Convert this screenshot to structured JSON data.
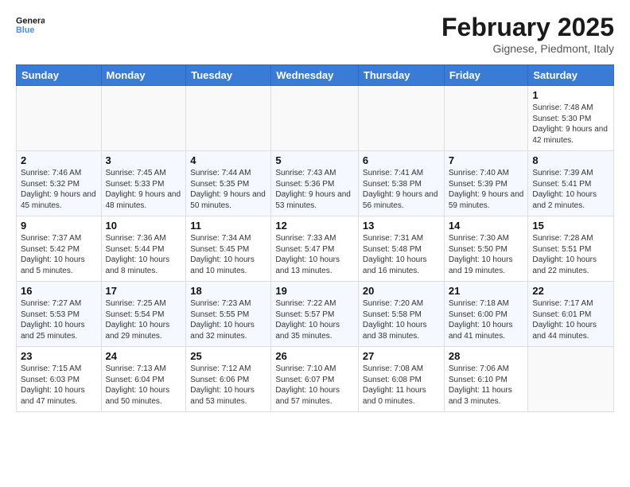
{
  "header": {
    "logo_line1": "General",
    "logo_line2": "Blue",
    "month_title": "February 2025",
    "location": "Gignese, Piedmont, Italy"
  },
  "weekdays": [
    "Sunday",
    "Monday",
    "Tuesday",
    "Wednesday",
    "Thursday",
    "Friday",
    "Saturday"
  ],
  "weeks": [
    [
      {
        "day": "",
        "info": ""
      },
      {
        "day": "",
        "info": ""
      },
      {
        "day": "",
        "info": ""
      },
      {
        "day": "",
        "info": ""
      },
      {
        "day": "",
        "info": ""
      },
      {
        "day": "",
        "info": ""
      },
      {
        "day": "1",
        "info": "Sunrise: 7:48 AM\nSunset: 5:30 PM\nDaylight: 9 hours and 42 minutes."
      }
    ],
    [
      {
        "day": "2",
        "info": "Sunrise: 7:46 AM\nSunset: 5:32 PM\nDaylight: 9 hours and 45 minutes."
      },
      {
        "day": "3",
        "info": "Sunrise: 7:45 AM\nSunset: 5:33 PM\nDaylight: 9 hours and 48 minutes."
      },
      {
        "day": "4",
        "info": "Sunrise: 7:44 AM\nSunset: 5:35 PM\nDaylight: 9 hours and 50 minutes."
      },
      {
        "day": "5",
        "info": "Sunrise: 7:43 AM\nSunset: 5:36 PM\nDaylight: 9 hours and 53 minutes."
      },
      {
        "day": "6",
        "info": "Sunrise: 7:41 AM\nSunset: 5:38 PM\nDaylight: 9 hours and 56 minutes."
      },
      {
        "day": "7",
        "info": "Sunrise: 7:40 AM\nSunset: 5:39 PM\nDaylight: 9 hours and 59 minutes."
      },
      {
        "day": "8",
        "info": "Sunrise: 7:39 AM\nSunset: 5:41 PM\nDaylight: 10 hours and 2 minutes."
      }
    ],
    [
      {
        "day": "9",
        "info": "Sunrise: 7:37 AM\nSunset: 5:42 PM\nDaylight: 10 hours and 5 minutes."
      },
      {
        "day": "10",
        "info": "Sunrise: 7:36 AM\nSunset: 5:44 PM\nDaylight: 10 hours and 8 minutes."
      },
      {
        "day": "11",
        "info": "Sunrise: 7:34 AM\nSunset: 5:45 PM\nDaylight: 10 hours and 10 minutes."
      },
      {
        "day": "12",
        "info": "Sunrise: 7:33 AM\nSunset: 5:47 PM\nDaylight: 10 hours and 13 minutes."
      },
      {
        "day": "13",
        "info": "Sunrise: 7:31 AM\nSunset: 5:48 PM\nDaylight: 10 hours and 16 minutes."
      },
      {
        "day": "14",
        "info": "Sunrise: 7:30 AM\nSunset: 5:50 PM\nDaylight: 10 hours and 19 minutes."
      },
      {
        "day": "15",
        "info": "Sunrise: 7:28 AM\nSunset: 5:51 PM\nDaylight: 10 hours and 22 minutes."
      }
    ],
    [
      {
        "day": "16",
        "info": "Sunrise: 7:27 AM\nSunset: 5:53 PM\nDaylight: 10 hours and 25 minutes."
      },
      {
        "day": "17",
        "info": "Sunrise: 7:25 AM\nSunset: 5:54 PM\nDaylight: 10 hours and 29 minutes."
      },
      {
        "day": "18",
        "info": "Sunrise: 7:23 AM\nSunset: 5:55 PM\nDaylight: 10 hours and 32 minutes."
      },
      {
        "day": "19",
        "info": "Sunrise: 7:22 AM\nSunset: 5:57 PM\nDaylight: 10 hours and 35 minutes."
      },
      {
        "day": "20",
        "info": "Sunrise: 7:20 AM\nSunset: 5:58 PM\nDaylight: 10 hours and 38 minutes."
      },
      {
        "day": "21",
        "info": "Sunrise: 7:18 AM\nSunset: 6:00 PM\nDaylight: 10 hours and 41 minutes."
      },
      {
        "day": "22",
        "info": "Sunrise: 7:17 AM\nSunset: 6:01 PM\nDaylight: 10 hours and 44 minutes."
      }
    ],
    [
      {
        "day": "23",
        "info": "Sunrise: 7:15 AM\nSunset: 6:03 PM\nDaylight: 10 hours and 47 minutes."
      },
      {
        "day": "24",
        "info": "Sunrise: 7:13 AM\nSunset: 6:04 PM\nDaylight: 10 hours and 50 minutes."
      },
      {
        "day": "25",
        "info": "Sunrise: 7:12 AM\nSunset: 6:06 PM\nDaylight: 10 hours and 53 minutes."
      },
      {
        "day": "26",
        "info": "Sunrise: 7:10 AM\nSunset: 6:07 PM\nDaylight: 10 hours and 57 minutes."
      },
      {
        "day": "27",
        "info": "Sunrise: 7:08 AM\nSunset: 6:08 PM\nDaylight: 11 hours and 0 minutes."
      },
      {
        "day": "28",
        "info": "Sunrise: 7:06 AM\nSunset: 6:10 PM\nDaylight: 11 hours and 3 minutes."
      },
      {
        "day": "",
        "info": ""
      }
    ]
  ]
}
